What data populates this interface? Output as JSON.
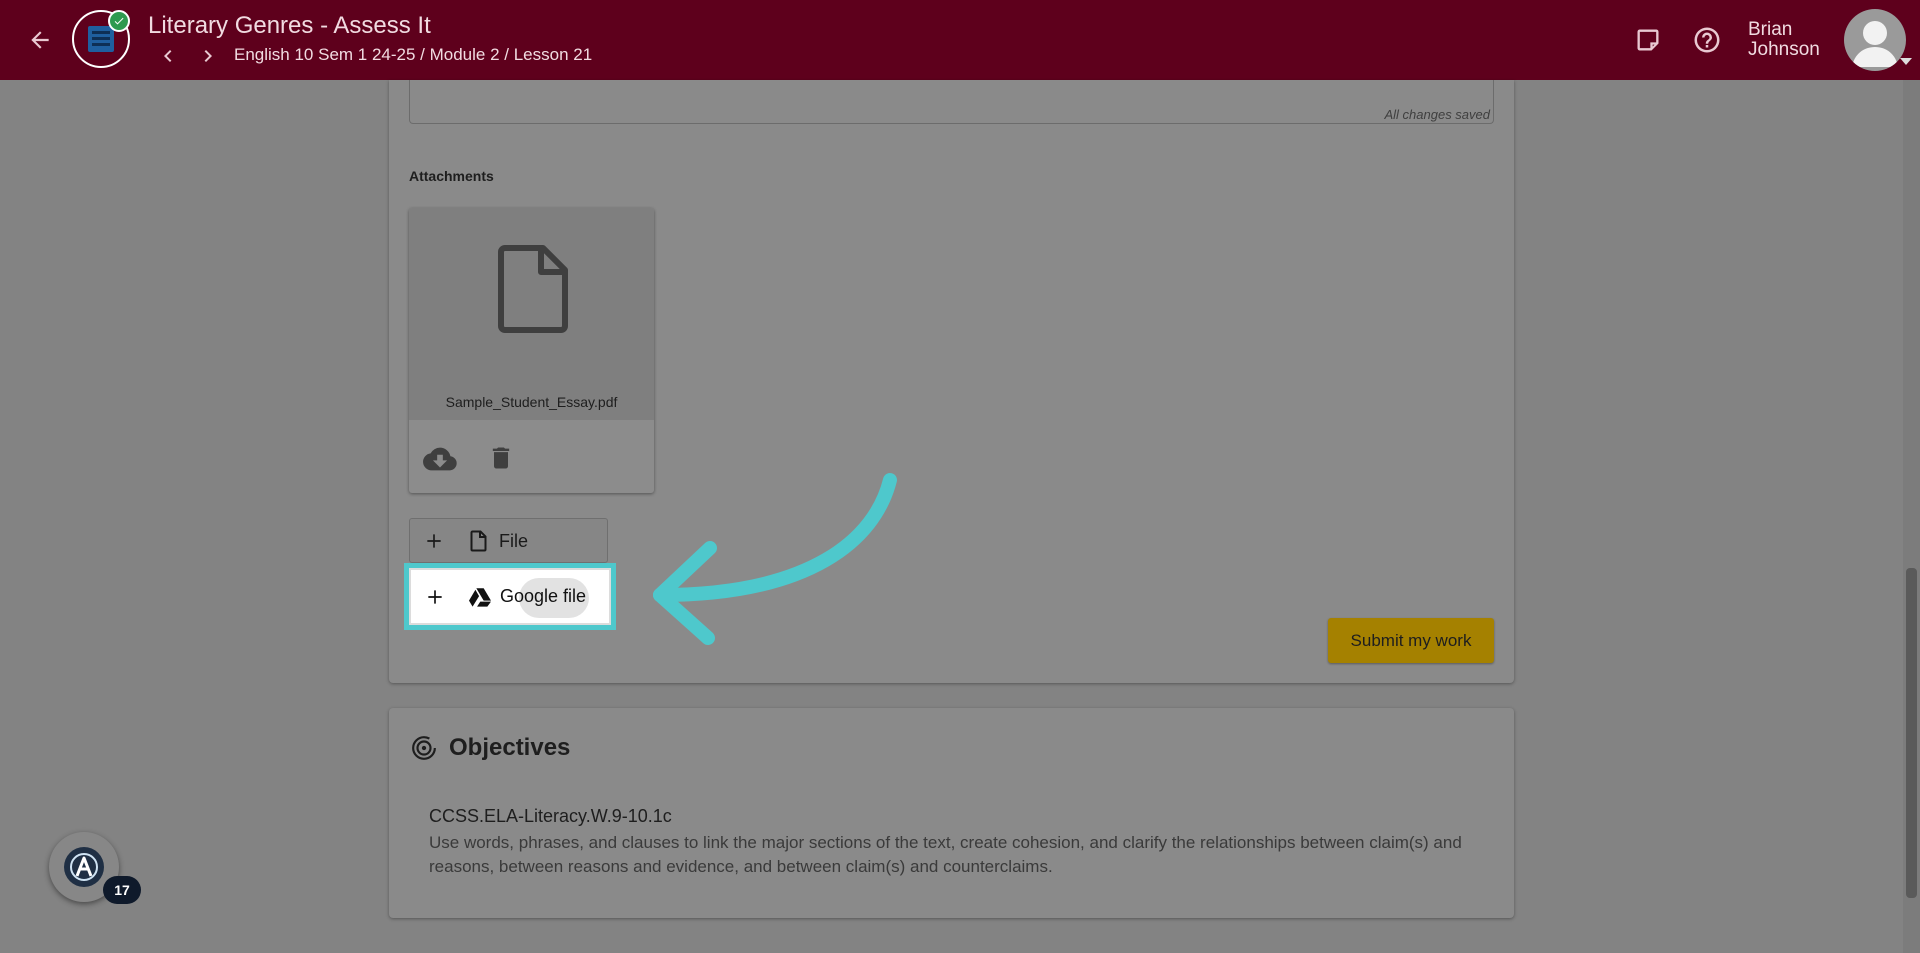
{
  "header": {
    "title": "Literary Genres - Assess It",
    "breadcrumb": "English 10 Sem 1 24-25 / Module 2 / Lesson 21",
    "user_first": "Brian",
    "user_last": "Johnson",
    "icons": [
      "arrow-back-icon",
      "chevron-left-icon",
      "chevron-right-icon",
      "sticky-note-icon",
      "help-circle-icon",
      "user-avatar-icon"
    ]
  },
  "editor": {
    "saved_status": "All changes saved"
  },
  "attachments": {
    "heading": "Attachments",
    "items": [
      {
        "file_name": "Sample_Student_Essay.pdf",
        "icons": [
          "document-icon",
          "cloud-download-icon",
          "trash-icon"
        ]
      }
    ],
    "add_file_label": "File",
    "add_google_file_label": "Google file"
  },
  "submit_label": "Submit my work",
  "objectives": {
    "title": "Objectives",
    "items": [
      {
        "code": "CCSS.ELA-Literacy.W.9-10.1c",
        "description": "Use words, phrases, and clauses to link the major sections of the text, create cohesion, and clarify the relationships between claim(s) and reasons, between reasons and evidence, and between claim(s) and counterclaims."
      }
    ]
  },
  "assistant": {
    "badge_count": "17"
  },
  "colors": {
    "header_bg": "#5e001c",
    "highlight": "#4ec8cc",
    "submit_bg": "#a58100",
    "overlay_bg": "#838383"
  }
}
